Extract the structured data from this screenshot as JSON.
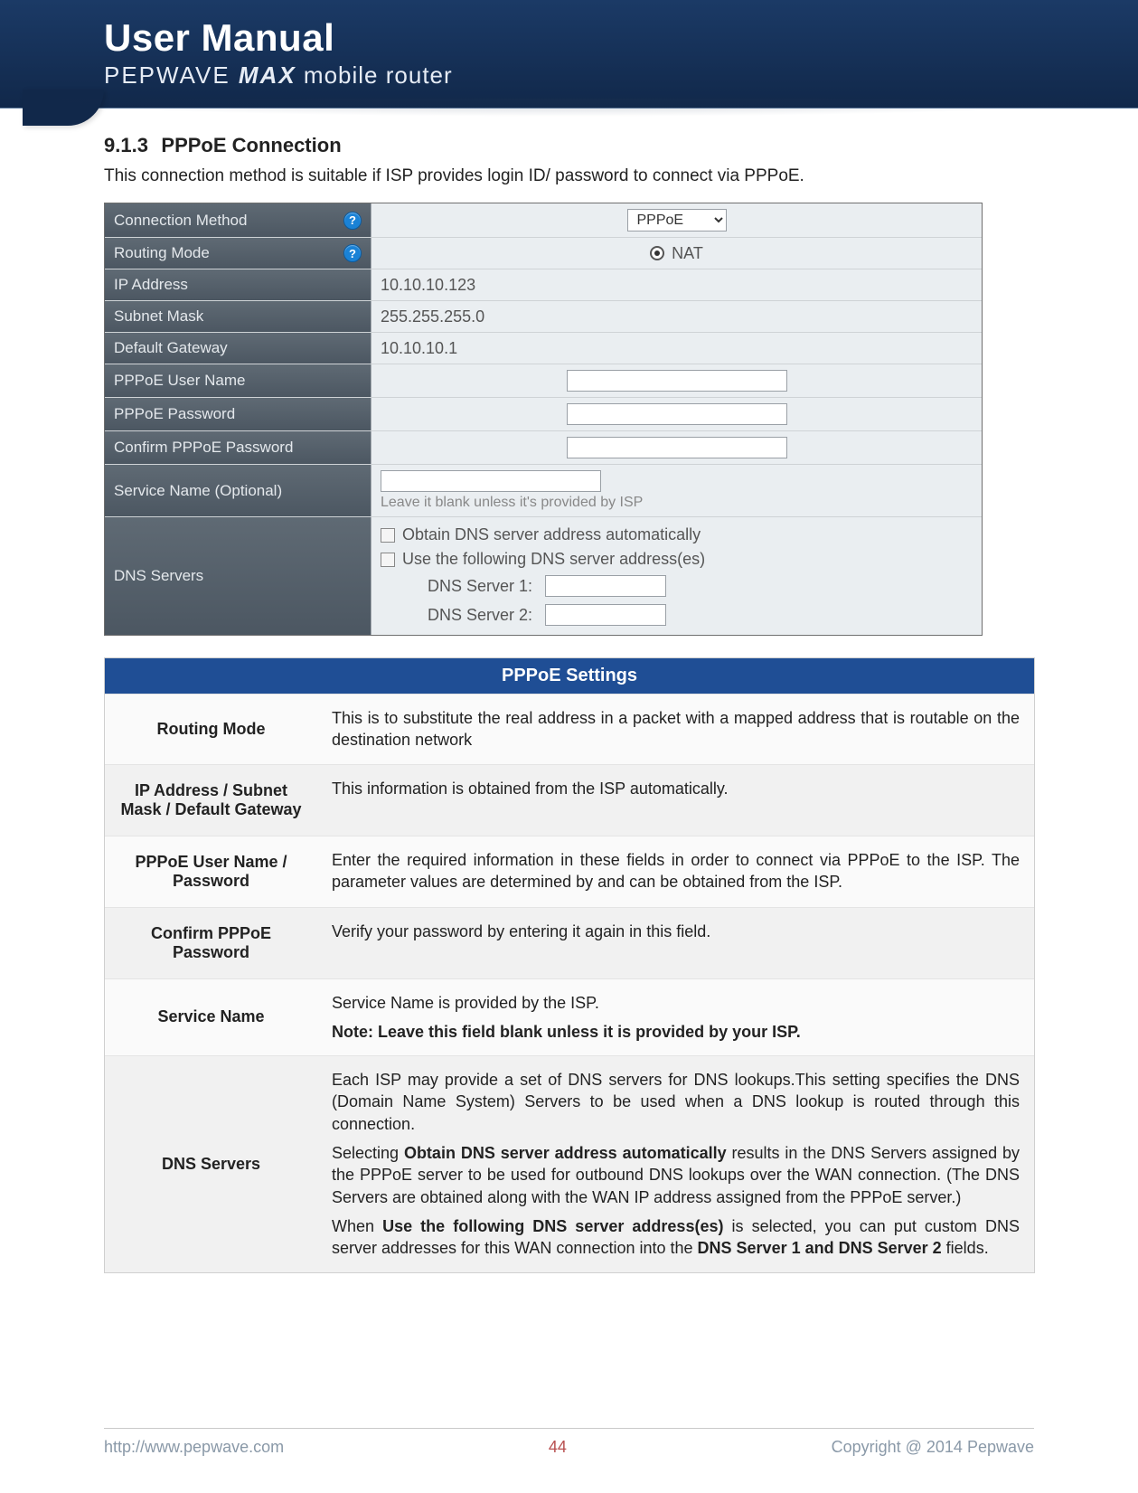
{
  "header": {
    "title": "User Manual",
    "brand_prefix": "PEPWAVE ",
    "brand_em": "MAX",
    "brand_suffix": " mobile router"
  },
  "section": {
    "number": "9.1.3",
    "title": "PPPoE Connection",
    "intro": "This connection method is suitable if ISP provides login ID/ password to connect via PPPoE."
  },
  "config": {
    "rows": {
      "connection_method": {
        "label": "Connection Method",
        "help": true,
        "value": "PPPoE"
      },
      "routing_mode": {
        "label": "Routing Mode",
        "help": true,
        "value": "NAT"
      },
      "ip_address": {
        "label": "IP Address",
        "value": "10.10.10.123"
      },
      "subnet_mask": {
        "label": "Subnet Mask",
        "value": "255.255.255.0"
      },
      "default_gateway": {
        "label": "Default Gateway",
        "value": "10.10.10.1"
      },
      "pppoe_user": {
        "label": "PPPoE User Name"
      },
      "pppoe_pass": {
        "label": "PPPoE Password"
      },
      "pppoe_pass2": {
        "label": "Confirm PPPoE Password"
      },
      "service_name": {
        "label": "Service Name (Optional)",
        "hint": "Leave it blank unless it's provided by ISP"
      },
      "dns": {
        "label": "DNS Servers",
        "opt_auto": "Obtain DNS server address automatically",
        "opt_manual": "Use the following DNS server address(es)",
        "dns1_label": "DNS Server 1:",
        "dns2_label": "DNS Server 2:"
      }
    }
  },
  "settings_table": {
    "title": "PPPoE Settings",
    "rows": [
      {
        "label": "Routing Mode",
        "desc": "This is to substitute the real address in a packet with a mapped address that is routable on the destination network"
      },
      {
        "label": "IP Address / Subnet Mask / Default Gateway",
        "desc": "This information is obtained from the ISP automatically."
      },
      {
        "label": "PPPoE User Name / Password",
        "desc": "Enter the required information in these fields in order to connect via PPPoE to the ISP. The parameter values are determined by and can be obtained from the ISP."
      },
      {
        "label": "Confirm PPPoE Password",
        "desc": "Verify your password by entering it again in this field."
      },
      {
        "label": "Service Name",
        "desc_line1": "Service Name is provided by the ISP.",
        "desc_line2": "Note: Leave this field blank unless it is provided by your ISP."
      },
      {
        "label": "DNS Servers",
        "p1": "Each ISP may provide a set of DNS servers for DNS lookups.This setting specifies the DNS (Domain Name System) Servers to be used when a DNS lookup is routed through this connection.",
        "p2_a": "Selecting ",
        "p2_b": "Obtain DNS server address automatically",
        "p2_c": " results in the DNS Servers assigned by the PPPoE server to be used for outbound DNS lookups over the WAN connection.  (The DNS Servers are obtained along with the WAN IP address assigned from the PPPoE server.)",
        "p3_a": "When ",
        "p3_b": "Use the following DNS server address(es)",
        "p3_c": " is selected, you can put custom DNS server addresses for this WAN connection into the ",
        "p3_d": "DNS Server 1 and DNS Server 2",
        "p3_e": " fields."
      }
    ]
  },
  "footer": {
    "url": "http://www.pepwave.com",
    "page": "44",
    "copyright": "Copyright @ 2014 Pepwave"
  }
}
